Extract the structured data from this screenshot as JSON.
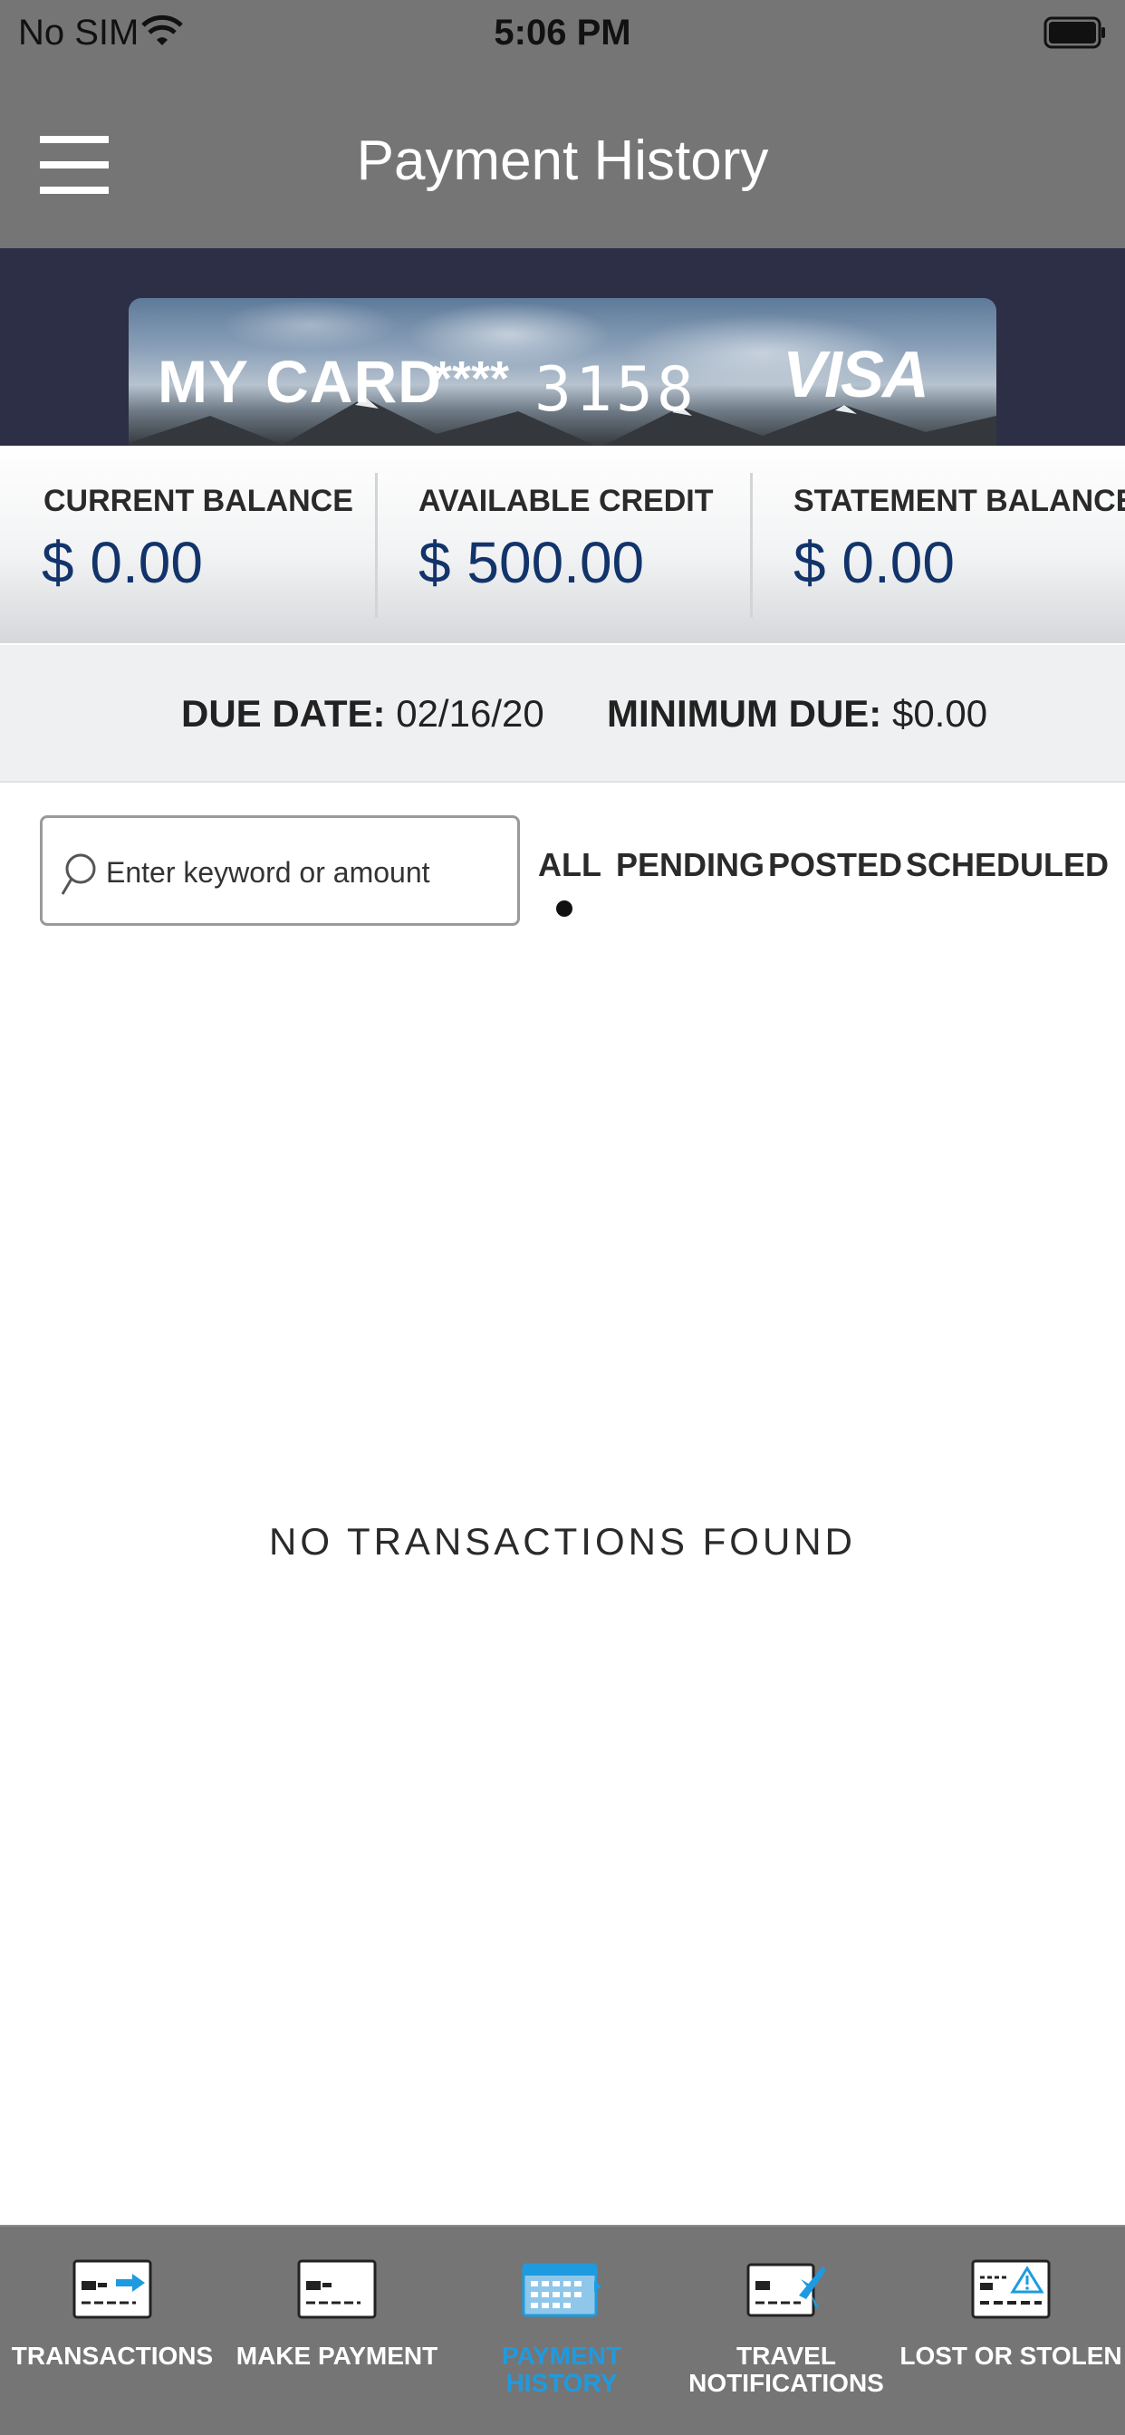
{
  "status_bar": {
    "carrier": "No SIM",
    "time": "5:06 PM"
  },
  "header": {
    "title": "Payment History"
  },
  "card": {
    "name": "MY CARD",
    "mask": "****",
    "last4": "3158",
    "brand": "VISA"
  },
  "balances": [
    {
      "label": "CURRENT BALANCE",
      "value": "$ 0.00"
    },
    {
      "label": "AVAILABLE CREDIT",
      "value": "$ 500.00"
    },
    {
      "label": "STATEMENT BALANCE",
      "value": "$ 0.00"
    }
  ],
  "due": {
    "due_date_label": "DUE DATE:",
    "due_date_value": "02/16/20",
    "minimum_due_label": "MINIMUM DUE:",
    "minimum_due_value": "$0.00"
  },
  "search": {
    "placeholder": "Enter keyword or amount"
  },
  "filters": {
    "all": "ALL",
    "pending": "PENDING",
    "posted": "POSTED",
    "scheduled": "SCHEDULED",
    "active": "ALL"
  },
  "empty_state": "NO TRANSACTIONS FOUND",
  "tabs": [
    {
      "label": "TRANSACTIONS"
    },
    {
      "label": "MAKE PAYMENT"
    },
    {
      "label_line1": "PAYMENT",
      "label_line2": "HISTORY"
    },
    {
      "label_line1": "TRAVEL",
      "label_line2": "NOTIFICATIONS"
    },
    {
      "label": "LOST OR STOLEN"
    }
  ],
  "colors": {
    "header": "#757575",
    "card_band": "#2c2f45",
    "balance_text": "#12346b",
    "active_tab": "#1e9be0"
  }
}
